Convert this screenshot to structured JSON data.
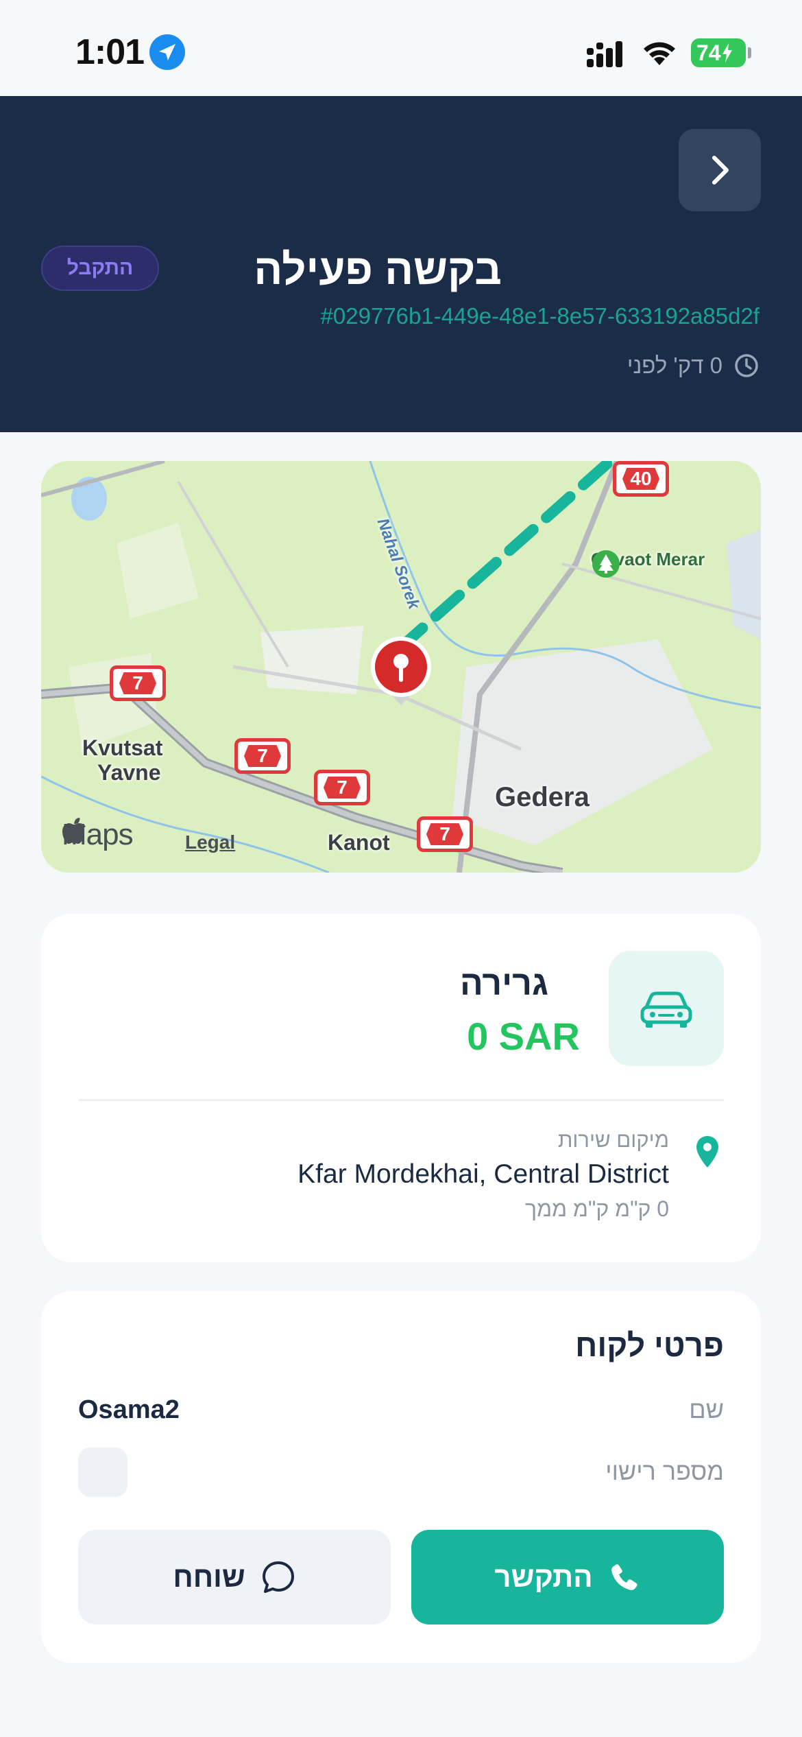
{
  "status_bar": {
    "time": "1:01",
    "battery": "74"
  },
  "header": {
    "status_badge": "התקבל",
    "title": "בקשה פעילה",
    "request_id": "#029776b1-449e-48e1-8e57-633192a85d2f",
    "time_ago": "0 דק' לפני"
  },
  "map": {
    "labels": {
      "kvutsat": "Kvutsat",
      "yavne": "Yavne",
      "gedera": "Gedera",
      "kanot": "Kanot",
      "gevaot": "Gevaot Merar",
      "nahal": "Nahal Sorek"
    },
    "routes": [
      "40",
      "7",
      "7",
      "7",
      "7"
    ],
    "maps_brand": "Maps",
    "legal": "Legal",
    "colors": {
      "land": "#dbeebf",
      "route_line": "#17b59b",
      "pin": "#d42a2a"
    }
  },
  "service": {
    "name": "גרירה",
    "price": "0 SAR",
    "location_label": "מיקום שירות",
    "location_value": "Kfar Mordekhai, Central District",
    "distance": "0 ק\"מ ק\"מ ממך",
    "icon": "car-icon"
  },
  "customer": {
    "title": "פרטי לקוח",
    "name_label": "שם",
    "name_value": "Osama2",
    "license_label": "מספר רישוי",
    "call_label": "התקשר",
    "chat_label": "שוחח"
  },
  "colors": {
    "header_bg": "#1b2c48",
    "accent": "#17b59b",
    "price": "#22c55e",
    "badge_text": "#8b7cf5"
  }
}
